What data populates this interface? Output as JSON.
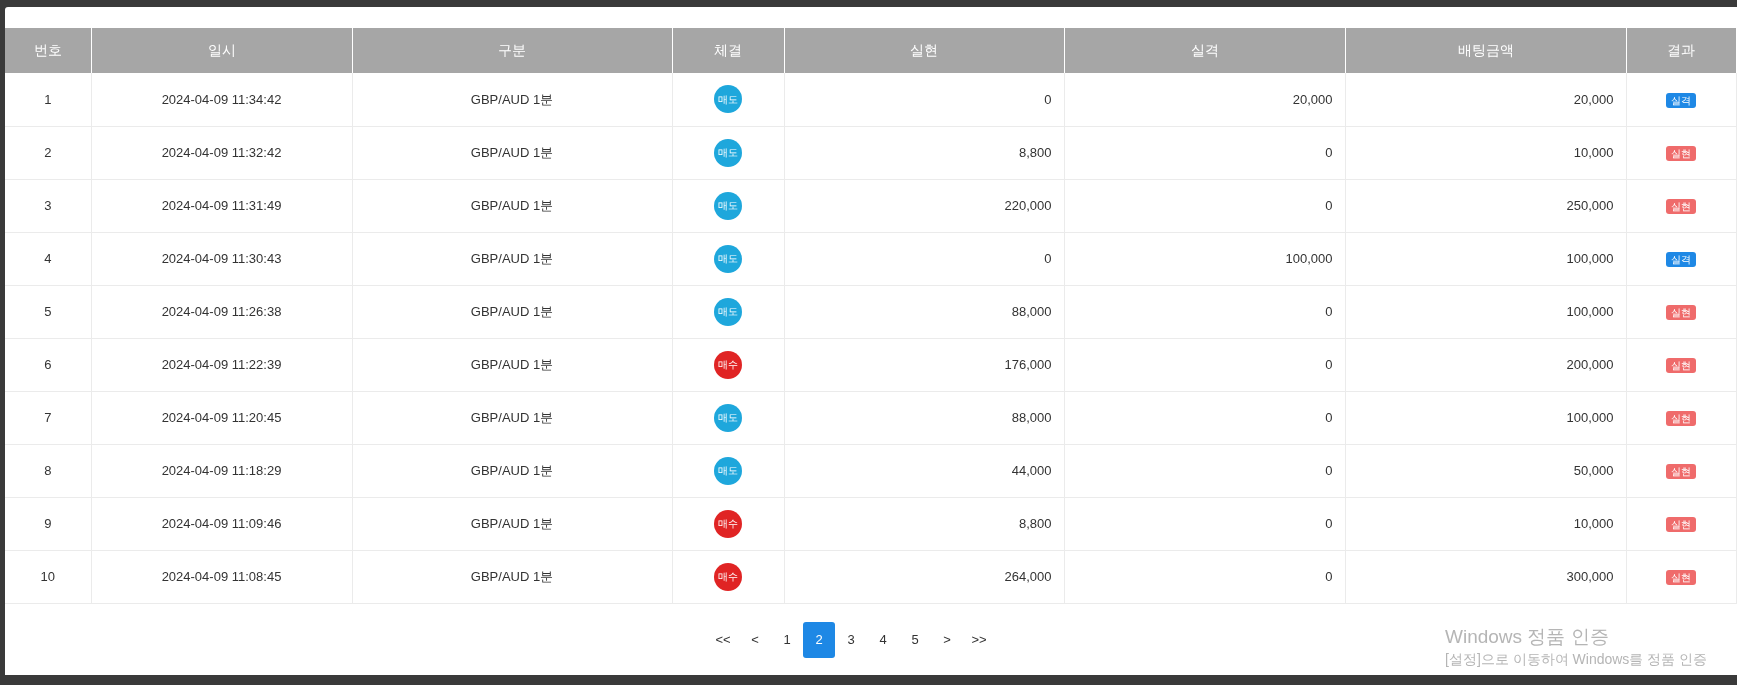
{
  "table": {
    "columns": [
      "번호",
      "일시",
      "구분",
      "체결",
      "실현",
      "실격",
      "배팅금액",
      "결과"
    ],
    "rows": [
      {
        "no": "1",
        "time": "2024-04-09 11:34:42",
        "type": "GBP/AUD 1분",
        "side": {
          "text": "매도",
          "kind": "sell"
        },
        "realized": "0",
        "lost": "20,000",
        "bet": "20,000",
        "result": {
          "text": "실격",
          "kind": "loss"
        }
      },
      {
        "no": "2",
        "time": "2024-04-09 11:32:42",
        "type": "GBP/AUD 1분",
        "side": {
          "text": "매도",
          "kind": "sell"
        },
        "realized": "8,800",
        "lost": "0",
        "bet": "10,000",
        "result": {
          "text": "실현",
          "kind": "win"
        }
      },
      {
        "no": "3",
        "time": "2024-04-09 11:31:49",
        "type": "GBP/AUD 1분",
        "side": {
          "text": "매도",
          "kind": "sell"
        },
        "realized": "220,000",
        "lost": "0",
        "bet": "250,000",
        "result": {
          "text": "실현",
          "kind": "win"
        }
      },
      {
        "no": "4",
        "time": "2024-04-09 11:30:43",
        "type": "GBP/AUD 1분",
        "side": {
          "text": "매도",
          "kind": "sell"
        },
        "realized": "0",
        "lost": "100,000",
        "bet": "100,000",
        "result": {
          "text": "실격",
          "kind": "loss"
        }
      },
      {
        "no": "5",
        "time": "2024-04-09 11:26:38",
        "type": "GBP/AUD 1분",
        "side": {
          "text": "매도",
          "kind": "sell"
        },
        "realized": "88,000",
        "lost": "0",
        "bet": "100,000",
        "result": {
          "text": "실현",
          "kind": "win"
        }
      },
      {
        "no": "6",
        "time": "2024-04-09 11:22:39",
        "type": "GBP/AUD 1분",
        "side": {
          "text": "매수",
          "kind": "buy"
        },
        "realized": "176,000",
        "lost": "0",
        "bet": "200,000",
        "result": {
          "text": "실현",
          "kind": "win"
        }
      },
      {
        "no": "7",
        "time": "2024-04-09 11:20:45",
        "type": "GBP/AUD 1분",
        "side": {
          "text": "매도",
          "kind": "sell"
        },
        "realized": "88,000",
        "lost": "0",
        "bet": "100,000",
        "result": {
          "text": "실현",
          "kind": "win"
        }
      },
      {
        "no": "8",
        "time": "2024-04-09 11:18:29",
        "type": "GBP/AUD 1분",
        "side": {
          "text": "매도",
          "kind": "sell"
        },
        "realized": "44,000",
        "lost": "0",
        "bet": "50,000",
        "result": {
          "text": "실현",
          "kind": "win"
        }
      },
      {
        "no": "9",
        "time": "2024-04-09 11:09:46",
        "type": "GBP/AUD 1분",
        "side": {
          "text": "매수",
          "kind": "buy"
        },
        "realized": "8,800",
        "lost": "0",
        "bet": "10,000",
        "result": {
          "text": "실현",
          "kind": "win"
        }
      },
      {
        "no": "10",
        "time": "2024-04-09 11:08:45",
        "type": "GBP/AUD 1분",
        "side": {
          "text": "매수",
          "kind": "buy"
        },
        "realized": "264,000",
        "lost": "0",
        "bet": "300,000",
        "result": {
          "text": "실현",
          "kind": "win"
        }
      }
    ]
  },
  "pagination": [
    {
      "label": "<<",
      "selected": false
    },
    {
      "label": "<",
      "selected": false
    },
    {
      "label": "1",
      "selected": false
    },
    {
      "label": "2",
      "selected": true
    },
    {
      "label": "3",
      "selected": false
    },
    {
      "label": "4",
      "selected": false
    },
    {
      "label": "5",
      "selected": false
    },
    {
      "label": ">",
      "selected": false
    },
    {
      "label": ">>",
      "selected": false
    }
  ],
  "activation_notice": {
    "title": "Windows 정품 인증",
    "message": "[설정]으로 이동하여 Windows를 정품 인증"
  }
}
